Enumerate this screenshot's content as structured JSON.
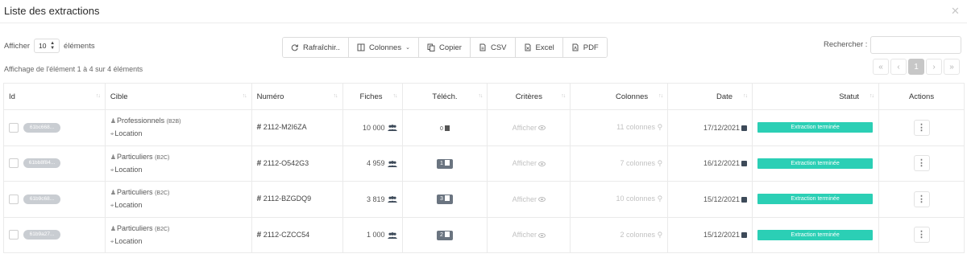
{
  "title": "Liste des extractions",
  "length": {
    "prefix": "Afficher",
    "value": "10",
    "suffix": "éléments"
  },
  "buttons": [
    {
      "label": "Rafraîchir..",
      "icon": "refresh-icon"
    },
    {
      "label": "Colonnes",
      "icon": "columns-icon"
    },
    {
      "label": "Copier",
      "icon": "copy-icon"
    },
    {
      "label": "CSV",
      "icon": "csv-icon"
    },
    {
      "label": "Excel",
      "icon": "excel-icon"
    },
    {
      "label": "PDF",
      "icon": "pdf-icon"
    }
  ],
  "search_label": "Rechercher :",
  "info": "Affichage de l'élément 1 à 4 sur 4 éléments",
  "pagination": {
    "first": "«",
    "prev": "‹",
    "current": "1",
    "next": "›",
    "last": "»"
  },
  "columns": [
    "Id",
    "Cible",
    "Numéro",
    "Fiches",
    "Téléch.",
    "Critères",
    "Colonnes",
    "Date",
    "Statut",
    "Actions"
  ],
  "rows": [
    {
      "id": "61bc668...",
      "cible": "Professionnels",
      "cible_tag": "(B2B)",
      "location": "Location",
      "numero": "2112-M2I6ZA",
      "fiches": "10 000",
      "telech": "0",
      "criteres": "Afficher",
      "colonnes": "11 colonnes",
      "date": "17/12/2021",
      "statut": "Extraction terminée"
    },
    {
      "id": "61bb8f84...",
      "cible": "Particuliers",
      "cible_tag": "(B2C)",
      "location": "Location",
      "numero": "2112-O542G3",
      "fiches": "4 959",
      "telech": "1",
      "criteres": "Afficher",
      "colonnes": "7 colonnes",
      "date": "16/12/2021",
      "statut": "Extraction terminée"
    },
    {
      "id": "61b9c68...",
      "cible": "Particuliers",
      "cible_tag": "(B2C)",
      "location": "Location",
      "numero": "2112-BZGDQ9",
      "fiches": "3 819",
      "telech": "3",
      "criteres": "Afficher",
      "colonnes": "10 colonnes",
      "date": "15/12/2021",
      "statut": "Extraction terminée"
    },
    {
      "id": "61b9a27...",
      "cible": "Particuliers",
      "cible_tag": "(B2C)",
      "location": "Location",
      "numero": "2112-CZCC54",
      "fiches": "1 000",
      "telech": "2",
      "criteres": "Afficher",
      "colonnes": "2 colonnes",
      "date": "15/12/2021",
      "statut": "Extraction terminée"
    }
  ],
  "colors": {
    "status": "#2bcfb5",
    "badge": "#6a7480",
    "pill": "#c9cdd2"
  }
}
